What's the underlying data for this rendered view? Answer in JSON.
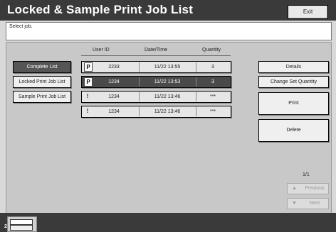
{
  "header": {
    "title": "Locked & Sample Print Job List",
    "exit_label": "Exit"
  },
  "instruction": "Select job.",
  "columns": [
    "User ID",
    "Date/Time",
    "Quantity"
  ],
  "filters": [
    {
      "label": "Complete List",
      "active": true
    },
    {
      "label": "Locked Print Job List",
      "active": false
    },
    {
      "label": "Sample Print Job List",
      "active": false
    }
  ],
  "jobs": [
    {
      "icon": "P",
      "user_id": "2233",
      "datetime": "11/22  13:55",
      "quantity": "3",
      "selected": false
    },
    {
      "icon": "P",
      "user_id": "1234",
      "datetime": "11/22  13:53",
      "quantity": "3",
      "selected": true
    },
    {
      "icon": "!",
      "user_id": "1234",
      "datetime": "11/22  13:46",
      "quantity": "***",
      "selected": false
    },
    {
      "icon": "!",
      "user_id": "1234",
      "datetime": "11/22  13:46",
      "quantity": "***",
      "selected": false
    }
  ],
  "actions": {
    "details": "Details",
    "change_quantity": "Change Set Quantity",
    "print": "Print",
    "delete": "Delete"
  },
  "pagination": {
    "page": "1/1",
    "previous": "Previous",
    "next": "Next"
  },
  "status_bar": {
    "tray_number": "2"
  }
}
